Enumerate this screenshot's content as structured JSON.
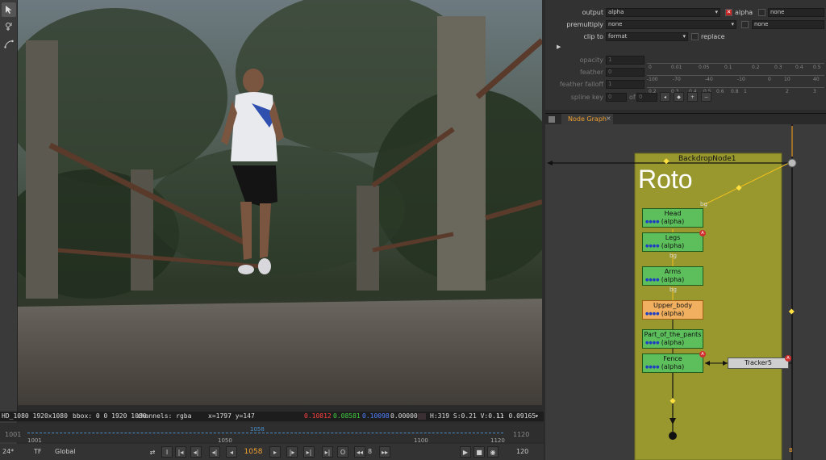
{
  "viewer": {
    "info": {
      "format": "HD_1080 1920x1080",
      "bbox": "bbox: 0 0 1920 1080",
      "channels": "channels: rgba",
      "coords": "x=1797 y=147",
      "r": "0.10812",
      "g": "0.08581",
      "b": "0.10098",
      "a": "0.00000",
      "hsv": "H:319 S:0.21 V:0.11",
      "lum": "L: 0.09165"
    }
  },
  "timeline": {
    "start_edge": "1001",
    "end_edge": "1120",
    "ticks": [
      "1001",
      "1050",
      "1100",
      "1120"
    ],
    "playhead_label": "1058",
    "current_frame_fraction": 0.48
  },
  "transport": {
    "fps": "24*",
    "tf": "TF",
    "global": "Global",
    "frame": "1058",
    "step": "8",
    "end": "120"
  },
  "properties": {
    "output_label": "output",
    "output_value": "alpha",
    "alpha_label": "alpha",
    "alpha_extra": "none",
    "premultiply_label": "premultiply",
    "premultiply_value": "none",
    "premultiply_extra": "none",
    "clipto_label": "clip to",
    "clipto_value": "format",
    "replace_label": "replace",
    "opacity_label": "opacity",
    "opacity_value": "1",
    "opacity_scale": [
      "0",
      "0.01",
      "0.05",
      "0.1",
      "0.2",
      "0.3",
      "0.4",
      "0.5"
    ],
    "feather_label": "feather",
    "feather_value": "0",
    "feather_scale": [
      "-100",
      "-70",
      "-40",
      "-10",
      "0",
      "10",
      "40"
    ],
    "falloff_label": "feather falloff",
    "falloff_value": "1",
    "falloff_scale": [
      "0.2",
      "0.3",
      "0.4",
      "0.5",
      "0.6",
      "0.8",
      "1",
      "2",
      "3"
    ],
    "spline_label": "spline key",
    "spline_value": "0",
    "spline_of": "of",
    "spline_total": "0"
  },
  "nodegraph": {
    "tab_label": "Node Graph",
    "close": "×",
    "backdrop_label": "BackdropNode1",
    "backdrop_title": "Roto",
    "bg_label": "bg",
    "b_label": "B",
    "nodes": [
      {
        "name": "Head",
        "sub": "(alpha)"
      },
      {
        "name": "Legs",
        "sub": "(alpha)"
      },
      {
        "name": "Arms",
        "sub": "(alpha)"
      },
      {
        "name": "Upper_body",
        "sub": "(alpha)"
      },
      {
        "name": "Part_of_the_pants",
        "sub": "(alpha)"
      },
      {
        "name": "Fence",
        "sub": "(alpha)"
      }
    ],
    "tracker": "Tracker5",
    "badge": "A"
  },
  "colors": {
    "accent": "#f0a030",
    "node_green": "#5cbf5c",
    "node_orange": "#f0b060",
    "backdrop": "#98982e"
  }
}
